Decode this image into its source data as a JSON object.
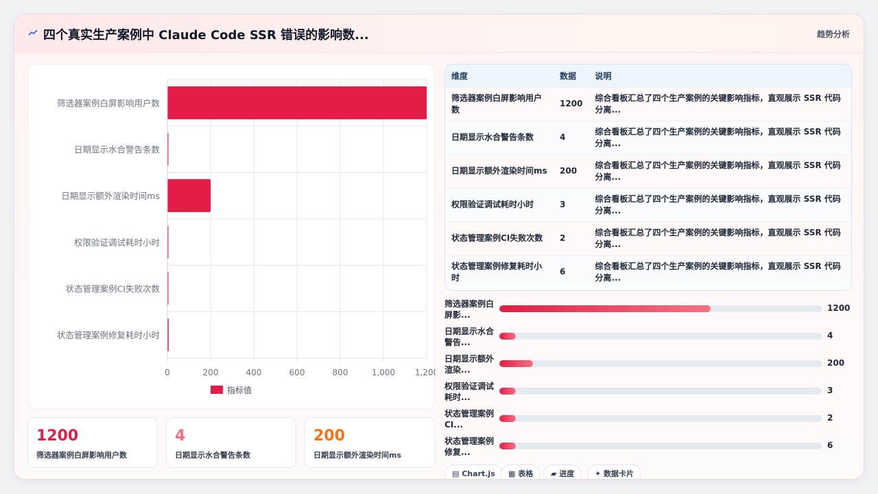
{
  "header": {
    "title": "四个真实生产案例中 Claude Code SSR 错误的影响数...",
    "tab_label": "趋势分析",
    "icon": "trend-icon"
  },
  "chart_data": {
    "type": "bar",
    "orientation": "horizontal",
    "categories": [
      "筛选器案例白屏影响用户数",
      "日期显示水合警告条数",
      "日期显示额外渲染时间ms",
      "权限验证调试耗时小时",
      "状态管理案例CI失败次数",
      "状态管理案例修复耗时小时"
    ],
    "series": [
      {
        "name": "指标值",
        "values": [
          1200,
          4,
          200,
          3,
          2,
          6
        ]
      }
    ],
    "xlim": [
      0,
      1200
    ],
    "xticks": [
      "0",
      "200",
      "400",
      "600",
      "800",
      "1,000",
      "1,200"
    ],
    "grid": true,
    "legend": "bottom",
    "color": "#e11d48"
  },
  "stats": [
    {
      "value": "1200",
      "label": "筛选器案例白屏影响用户数",
      "color": "#e11d48"
    },
    {
      "value": "4",
      "label": "日期显示水合警告条数",
      "color": "#f87185"
    },
    {
      "value": "200",
      "label": "日期显示额外渲染时间ms",
      "color": "#f97316"
    }
  ],
  "table": {
    "headers": [
      "维度",
      "数据",
      "说明"
    ],
    "rows": [
      {
        "dim": "筛选器案例白屏影响用户数",
        "val": "1200",
        "desc": "综合看板汇总了四个生产案例的关键影响指标，直观展示 SSR 代码分离..."
      },
      {
        "dim": "日期显示水合警告条数",
        "val": "4",
        "desc": "综合看板汇总了四个生产案例的关键影响指标，直观展示 SSR 代码分离..."
      },
      {
        "dim": "日期显示额外渲染时间ms",
        "val": "200",
        "desc": "综合看板汇总了四个生产案例的关键影响指标，直观展示 SSR 代码分离..."
      },
      {
        "dim": "权限验证调试耗时小时",
        "val": "3",
        "desc": "综合看板汇总了四个生产案例的关键影响指标，直观展示 SSR 代码分离..."
      },
      {
        "dim": "状态管理案例CI失败次数",
        "val": "2",
        "desc": "综合看板汇总了四个生产案例的关键影响指标，直观展示 SSR 代码分离..."
      },
      {
        "dim": "状态管理案例修复耗时小时",
        "val": "6",
        "desc": "综合看板汇总了四个生产案例的关键影响指标，直观展示 SSR 代码分离..."
      }
    ]
  },
  "progress": [
    {
      "label": "筛选器案例白屏影...",
      "value": "1200",
      "fill": 0.655
    },
    {
      "label": "日期显示水合警告...",
      "value": "4",
      "fill": 0.05
    },
    {
      "label": "日期显示额外渲染...",
      "value": "200",
      "fill": 0.105
    },
    {
      "label": "权限验证调试耗时...",
      "value": "3",
      "fill": 0.05
    },
    {
      "label": "状态管理案例CI...",
      "value": "2",
      "fill": 0.05
    },
    {
      "label": "状态管理案例修复...",
      "value": "6",
      "fill": 0.05
    }
  ],
  "chips": [
    {
      "label": "Chart.js",
      "icon": "chart-icon"
    },
    {
      "label": "表格",
      "icon": "table-icon"
    },
    {
      "label": "进度",
      "icon": "progress-icon"
    },
    {
      "label": "数据卡片",
      "icon": "sparkle-icon"
    }
  ]
}
